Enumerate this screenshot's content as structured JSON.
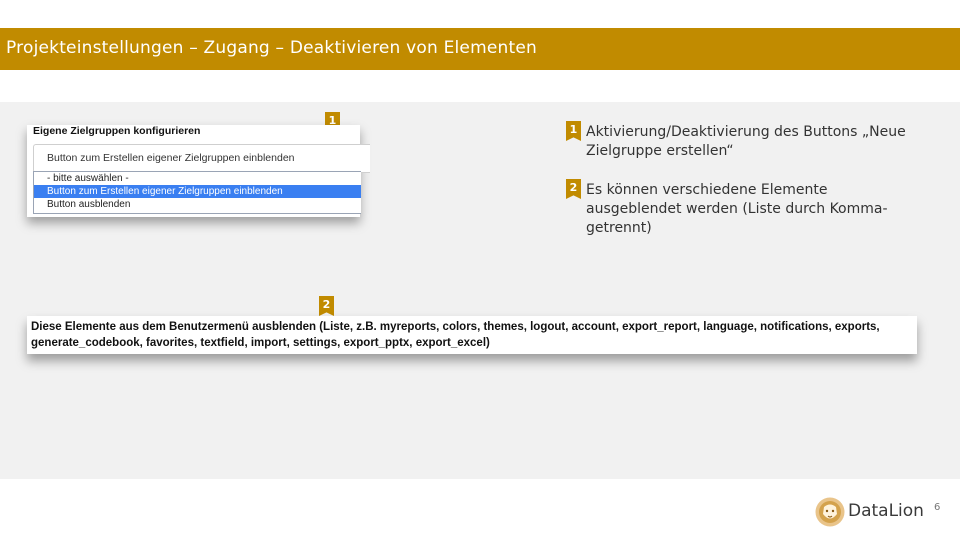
{
  "header": {
    "title": "Projekteinstellungen – Zugang – Deaktivieren von Elementen"
  },
  "shot1": {
    "label": "Eigene Zielgruppen konfigurieren",
    "selected_value": "Button zum Erstellen eigener Zielgruppen einblenden",
    "options": [
      "- bitte auswählen -",
      "Button zum Erstellen eigener Zielgruppen einblenden",
      "Button ausblenden"
    ]
  },
  "shot2": {
    "text": "Diese Elemente aus dem Benutzermenü ausblenden (Liste, z.B. myreports, colors, themes, logout, account, export_report, language, notifications, exports, generate_codebook, favorites, textfield, import, settings, export_pptx, export_excel)"
  },
  "badges": {
    "one": "1",
    "two": "2"
  },
  "notes": [
    {
      "number": "1",
      "text": "Aktivierung/Deaktivierung des Buttons „Neue Zielgruppe erstellen“"
    },
    {
      "number": "2",
      "text": "Es können verschiedene Elemente ausgeblendet werden (Liste durch Komma-getrennt)"
    }
  ],
  "footer": {
    "brand": "DataLion",
    "page": "6"
  },
  "colors": {
    "accent": "#c18b00",
    "selection": "#3a7ff1",
    "panel": "#f1f1f1"
  }
}
